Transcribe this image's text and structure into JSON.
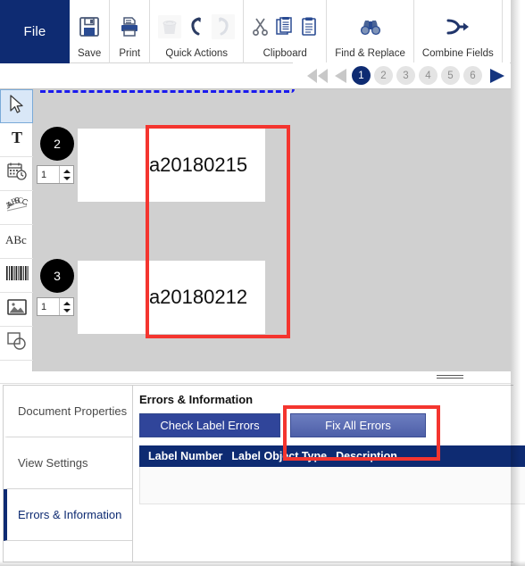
{
  "ribbon": {
    "file_label": "File",
    "groups": [
      {
        "label": "Save",
        "icons": [
          "save-icon"
        ]
      },
      {
        "label": "Print",
        "icons": [
          "print-icon"
        ]
      },
      {
        "label": "Quick Actions",
        "icons": [
          "delete-icon",
          "undo-icon",
          "redo-icon"
        ]
      },
      {
        "label": "Clipboard",
        "icons": [
          "cut-icon",
          "copy-icon",
          "paste-icon"
        ]
      },
      {
        "label": "Find & Replace",
        "icons": [
          "binoculars-icon"
        ]
      },
      {
        "label": "Combine Fields",
        "icons": [
          "merge-arrow-icon"
        ]
      }
    ]
  },
  "pager": {
    "first_icon": "double-left-arrow-icon",
    "prev_icon": "left-arrow-icon",
    "next_icon": "right-arrow-icon",
    "pages": [
      "1",
      "2",
      "3",
      "4",
      "5",
      "6"
    ],
    "active_page": "1"
  },
  "tools": {
    "items": [
      {
        "name": "select-tool",
        "icon": "cursor-arrow-icon",
        "selected": true
      },
      {
        "name": "text-tool",
        "icon": "text-t-icon",
        "selected": false
      },
      {
        "name": "datetime-tool",
        "icon": "calendar-clock-icon",
        "selected": false
      },
      {
        "name": "curved-text-tool",
        "icon": "curved-abc-icon",
        "selected": false
      },
      {
        "name": "paragraph-tool",
        "icon": "abc-text-icon",
        "selected": false
      },
      {
        "name": "barcode-tool",
        "icon": "barcode-icon",
        "selected": false
      },
      {
        "name": "image-tool",
        "icon": "picture-icon",
        "selected": false
      },
      {
        "name": "shape-tool",
        "icon": "shapes-icon",
        "selected": false
      }
    ]
  },
  "canvas": {
    "background_color": "#d0d0d0",
    "selection_color": "#1a1aee",
    "annotation_color": "#f4352f",
    "labels": [
      {
        "badge": "2",
        "copies": "1",
        "text": "a20180215"
      },
      {
        "badge": "3",
        "copies": "1",
        "text": "a20180212"
      }
    ]
  },
  "bottom_panel": {
    "tabs": [
      {
        "label": "Document Properties",
        "active": false
      },
      {
        "label": "View Settings",
        "active": false
      },
      {
        "label": "Errors & Information",
        "active": true
      }
    ],
    "title": "Errors & Information",
    "buttons": [
      {
        "label": "Check Label Errors",
        "style": "primary"
      },
      {
        "label": "Fix All Errors",
        "style": "hover"
      }
    ],
    "grid": {
      "columns": [
        "Label Number",
        "Label Object Type",
        "Description"
      ],
      "rows": []
    }
  },
  "colors": {
    "brand_navy": "#0e2b72",
    "button_blue": "#30459a",
    "annotation_red": "#f4352f",
    "canvas_grey": "#d0d0d0"
  }
}
